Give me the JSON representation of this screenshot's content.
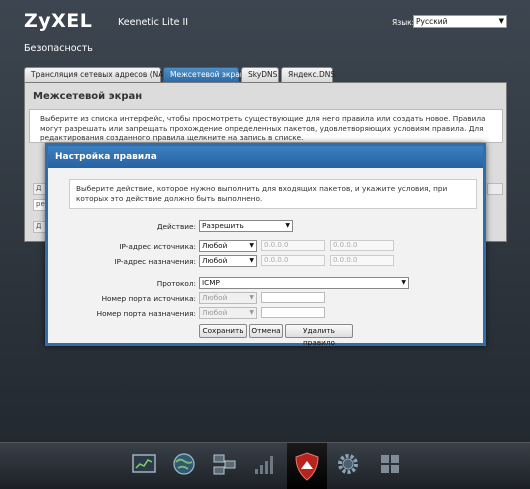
{
  "app": {
    "logo": "ZyXEL",
    "model": "Keenetic Lite II",
    "language_label": "Язык:",
    "language_value": "Русский"
  },
  "section_title": "Безопасность",
  "tabs": [
    {
      "label": "Трансляция сетевых адресов (NAT)",
      "active": false
    },
    {
      "label": "Межсетевой экран",
      "active": true
    },
    {
      "label": "SkyDNS",
      "active": false
    },
    {
      "label": "Яндекс.DNS",
      "active": false
    }
  ],
  "main": {
    "heading": "Межсетевой экран",
    "description": "Выберите из списка интерфейс, чтобы просмотреть существующие для него правила или создать новое. Правила могут разрешать или запрещать прохождение определенных пакетов, удовлетворяющих условиям правила. Для редактирования созданного правила щелкните на запись в списке.",
    "stub1": "Д",
    "stub2": "ре",
    "stub3": "Д"
  },
  "modal": {
    "title": "Настройка правила",
    "description": "Выберите действие, которое нужно выполнить для входящих пакетов, и укажите условия, при которых это действие должно быть выполнено.",
    "action_label": "Действие:",
    "action_value": "Разрешить",
    "src_ip_label": "IP-адрес источника:",
    "src_ip_mode": "Любой",
    "src_ip_addr": "0.0.0.0",
    "src_ip_mask": "0.0.0.0",
    "dst_ip_label": "IP-адрес назначения:",
    "dst_ip_mode": "Любой",
    "dst_ip_addr": "0.0.0.0",
    "dst_ip_mask": "0.0.0.0",
    "protocol_label": "Протокол:",
    "protocol_value": "ICMP",
    "src_port_label": "Номер порта источника:",
    "src_port_mode": "Любой",
    "dst_port_label": "Номер порта назначения:",
    "dst_port_mode": "Любой",
    "save_label": "Сохранить",
    "cancel_label": "Отмена",
    "delete_label": "Удалить правило"
  },
  "dock": {
    "items": [
      "monitor-icon",
      "globe-icon",
      "network-icon",
      "signal-icon",
      "shield-icon",
      "gear-icon",
      "apps-icon"
    ],
    "active": "shield-icon"
  }
}
